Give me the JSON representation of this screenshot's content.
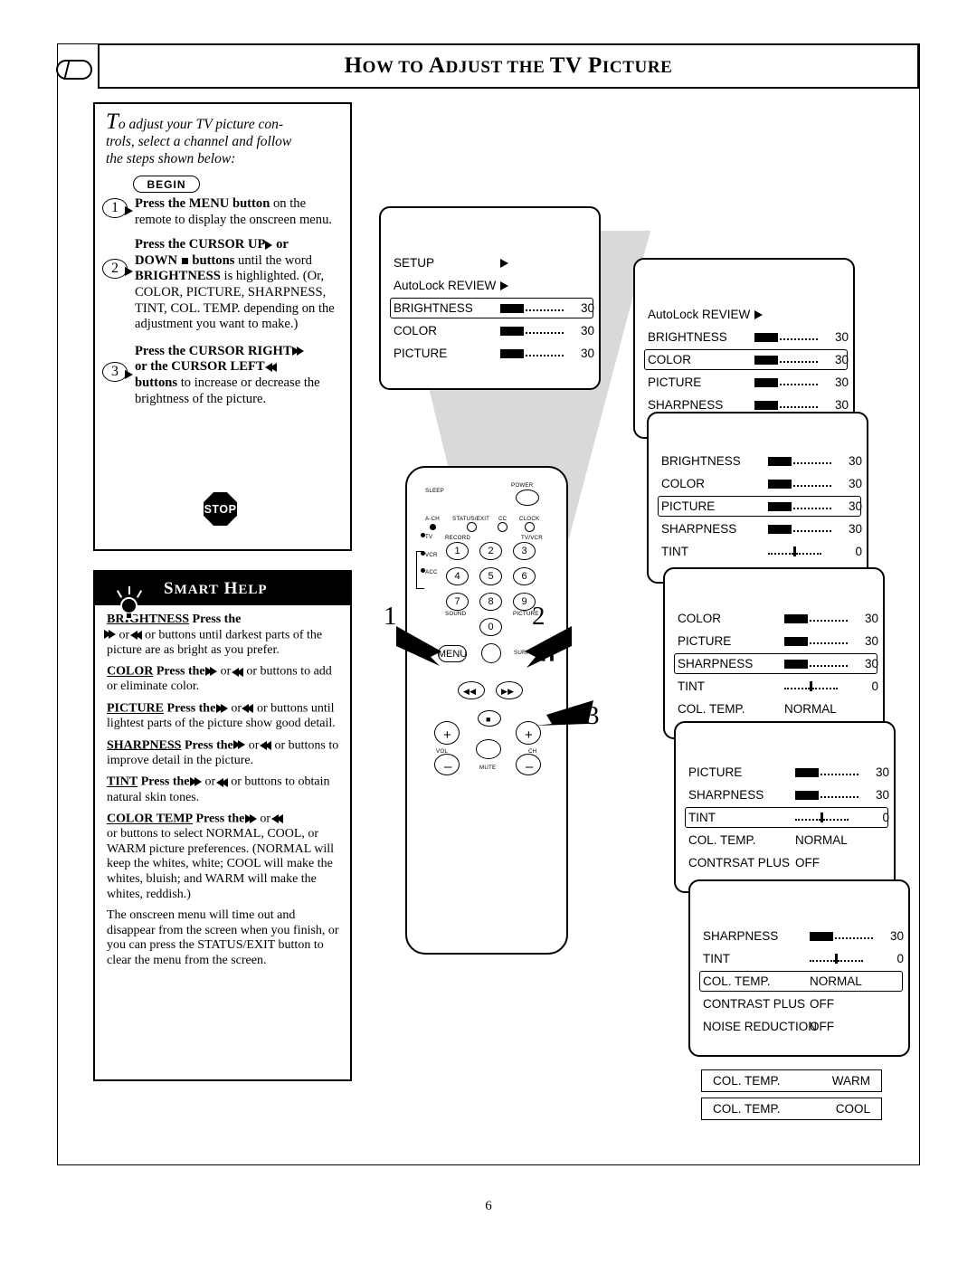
{
  "header": {
    "title_small_caps": "HOW TO ADJUST THE TV PICTURE",
    "part1": "H",
    "part1b": "OW TO ",
    "part2": "A",
    "part2b": "DJUST THE ",
    "part3": "TV P",
    "part3b": "ICTURE"
  },
  "page_number": "6",
  "intro": {
    "dropcap": "T",
    "text": "o adjust your TV picture con- trols, select a channel and follow the steps shown below:"
  },
  "begin_label": "BEGIN",
  "steps": [
    {
      "num": "1",
      "text_html": "Press the MENU button on the remote to display the onscreen menu."
    },
    {
      "num": "2",
      "text_html": "Press the CURSOR UP or DOWN buttons until the word BRIGHTNESS is highlighted. (Or, COLOR, PICTURE, SHARPNESS, TINT, COL. TEMP. depending on the adjustment you want to make.)"
    },
    {
      "num": "3",
      "text_html": "Press the CURSOR RIGHT or the CURSOR LEFT buttons to increase or decrease the brightness of the picture."
    }
  ],
  "step_fragments": {
    "s1a": "Press the MENU button",
    "s1b": " on the remote to display the onscreen menu.",
    "s2a": "Press the CURSOR UP",
    "s2b": " or",
    "s2c": "DOWN",
    "s2d": " buttons",
    "s2e": " until the word ",
    "s2f": "BRIGHTNESS",
    "s2g": " is highlighted. (Or, COLOR, PICTURE, SHARPNESS, TINT, COL. TEMP. depending on the adjustment you want to make.)",
    "s3a": "Press the CURSOR RIGHT",
    "s3b": "or the CURSOR LEFT",
    "s3c": "buttons",
    "s3d": " to increase or decrease the brightness of the picture."
  },
  "stop_label": "STOP",
  "smart_help": {
    "title": "SMART HELP",
    "entries": [
      {
        "term": "BRIGHTNESS",
        "lead": "Press the",
        "rest": "or buttons until darkest parts of the picture are as bright as you prefer."
      },
      {
        "term": "COLOR",
        "lead": "Press the",
        "rest": "or buttons to add or eliminate color."
      },
      {
        "term": "PICTURE",
        "lead": "Press the",
        "rest": "or buttons until lightest parts of the picture show good detail."
      },
      {
        "term": "SHARPNESS",
        "lead": "Press the",
        "rest": "or buttons to improve detail in the picture."
      },
      {
        "term": "TINT",
        "lead": "Press the",
        "rest": "or buttons to obtain natural skin tones."
      },
      {
        "term": "COLOR TEMP",
        "lead": "Press the",
        "rest": "or buttons to select NORMAL, COOL, or WARM picture preferences. (NORMAL will keep the whites, white; COOL will make the whites, bluish; and WARM will make the whites, reddish.)"
      }
    ],
    "closing": "The onscreen menu will time out and disappear from the screen when you finish, or you can press the STATUS/EXIT button to clear the menu from the screen."
  },
  "remote": {
    "labels": {
      "sleep": "SLEEP",
      "power": "POWER",
      "ach": "A-CH",
      "statusexit": "STATUS/EXIT",
      "cc": "CC",
      "clock": "CLOCK",
      "tv": "TV",
      "vcr": "VCR",
      "acc": "ACC",
      "record": "RECORD",
      "tvvcr": "TV/VCR",
      "sound": "SOUND",
      "picture": "PICTURE",
      "menu": "MENU",
      "surf": "SURF",
      "vol": "VOL",
      "ch": "CH",
      "mute": "MUTE"
    },
    "numbers": [
      "1",
      "2",
      "3",
      "4",
      "5",
      "6",
      "7",
      "8",
      "9",
      "0"
    ]
  },
  "callouts": {
    "one": "1",
    "two": "2",
    "three": "3"
  },
  "osd_panels": [
    {
      "id": "panel-1",
      "rows": [
        {
          "label": "SETUP",
          "type": "arrow"
        },
        {
          "label": "AutoLock REVIEW",
          "type": "arrow"
        },
        {
          "label": "BRIGHTNESS",
          "type": "bar",
          "value": "30",
          "highlight": true
        },
        {
          "label": "COLOR",
          "type": "bar",
          "value": "30"
        },
        {
          "label": "PICTURE",
          "type": "bar",
          "value": "30"
        }
      ]
    },
    {
      "id": "panel-2",
      "rows": [
        {
          "label": "AutoLock REVIEW",
          "type": "arrow"
        },
        {
          "label": "BRIGHTNESS",
          "type": "bar",
          "value": "30"
        },
        {
          "label": "COLOR",
          "type": "bar",
          "value": "30",
          "highlight": true
        },
        {
          "label": "PICTURE",
          "type": "bar",
          "value": "30"
        },
        {
          "label": "SHARPNESS",
          "type": "bar",
          "value": "30"
        }
      ]
    },
    {
      "id": "panel-3",
      "rows": [
        {
          "label": "BRIGHTNESS",
          "type": "bar",
          "value": "30"
        },
        {
          "label": "COLOR",
          "type": "bar",
          "value": "30"
        },
        {
          "label": "PICTURE",
          "type": "bar",
          "value": "30",
          "highlight": true
        },
        {
          "label": "SHARPNESS",
          "type": "bar",
          "value": "30"
        },
        {
          "label": "TINT",
          "type": "center",
          "value": "0"
        }
      ]
    },
    {
      "id": "panel-4",
      "rows": [
        {
          "label": "COLOR",
          "type": "bar",
          "value": "30"
        },
        {
          "label": "PICTURE",
          "type": "bar",
          "value": "30"
        },
        {
          "label": "SHARPNESS",
          "type": "bar",
          "value": "30",
          "highlight": true
        },
        {
          "label": "TINT",
          "type": "center",
          "value": "0"
        },
        {
          "label": "COL. TEMP.",
          "type": "text",
          "value": "NORMAL"
        }
      ]
    },
    {
      "id": "panel-5",
      "rows": [
        {
          "label": "PICTURE",
          "type": "bar",
          "value": "30"
        },
        {
          "label": "SHARPNESS",
          "type": "bar",
          "value": "30"
        },
        {
          "label": "TINT",
          "type": "center",
          "value": "0",
          "highlight": true
        },
        {
          "label": "COL. TEMP.",
          "type": "text",
          "value": "NORMAL"
        },
        {
          "label": "CONTRSAT PLUS",
          "type": "text",
          "value": "OFF"
        }
      ]
    },
    {
      "id": "panel-6",
      "rows": [
        {
          "label": "SHARPNESS",
          "type": "bar",
          "value": "30"
        },
        {
          "label": "TINT",
          "type": "center",
          "value": "0"
        },
        {
          "label": "COL. TEMP.",
          "type": "text",
          "value": "NORMAL",
          "highlight": true
        },
        {
          "label": "CONTRAST PLUS",
          "type": "text",
          "value": "OFF"
        },
        {
          "label": "NOISE REDUCTION",
          "type": "text",
          "value": "OFF"
        }
      ]
    }
  ],
  "temp_boxes": [
    {
      "label": "COL. TEMP.",
      "value": "WARM"
    },
    {
      "label": "COL. TEMP.",
      "value": "COOL"
    }
  ]
}
